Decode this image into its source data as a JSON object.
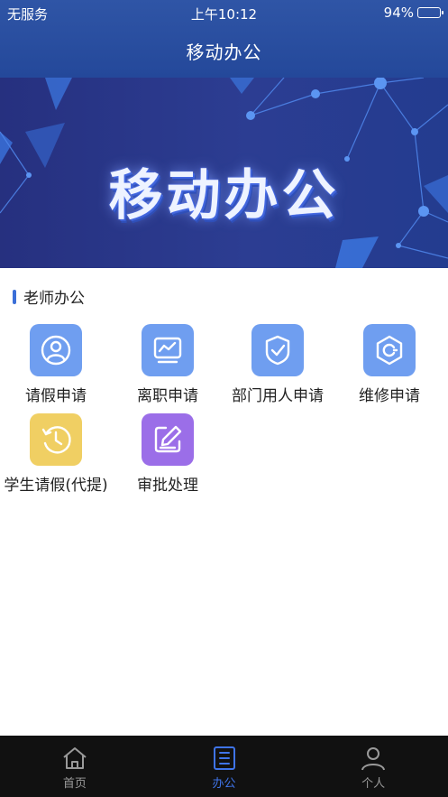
{
  "status_bar": {
    "carrier": "无服务",
    "time": "上午10:12",
    "battery": "94%",
    "battery_level": 0.94
  },
  "nav": {
    "title": "移动办公"
  },
  "banner": {
    "text": "移动办公"
  },
  "section": {
    "title": "老师办公"
  },
  "items": [
    {
      "label": "请假申请",
      "icon": "user-circle-icon",
      "color": "#6f9ef0"
    },
    {
      "label": "离职申请",
      "icon": "monitor-chart-icon",
      "color": "#6f9ef0"
    },
    {
      "label": "部门用人申请",
      "icon": "shield-check-icon",
      "color": "#6f9ef0"
    },
    {
      "label": "维修申请",
      "icon": "hexagon-wrench-icon",
      "color": "#6f9ef0"
    },
    {
      "label": "学生请假(代提)",
      "icon": "history-clock-icon",
      "color": "#f0cf63"
    },
    {
      "label": "审批处理",
      "icon": "edit-note-icon",
      "color": "#9b6ee8"
    }
  ],
  "tabbar": {
    "tabs": [
      {
        "label": "首页",
        "icon": "home-icon",
        "active": false
      },
      {
        "label": "办公",
        "icon": "document-list-icon",
        "active": true
      },
      {
        "label": "个人",
        "icon": "person-icon",
        "active": false
      }
    ],
    "active_color": "#3f74e8",
    "inactive_color": "#9a9a9a"
  }
}
